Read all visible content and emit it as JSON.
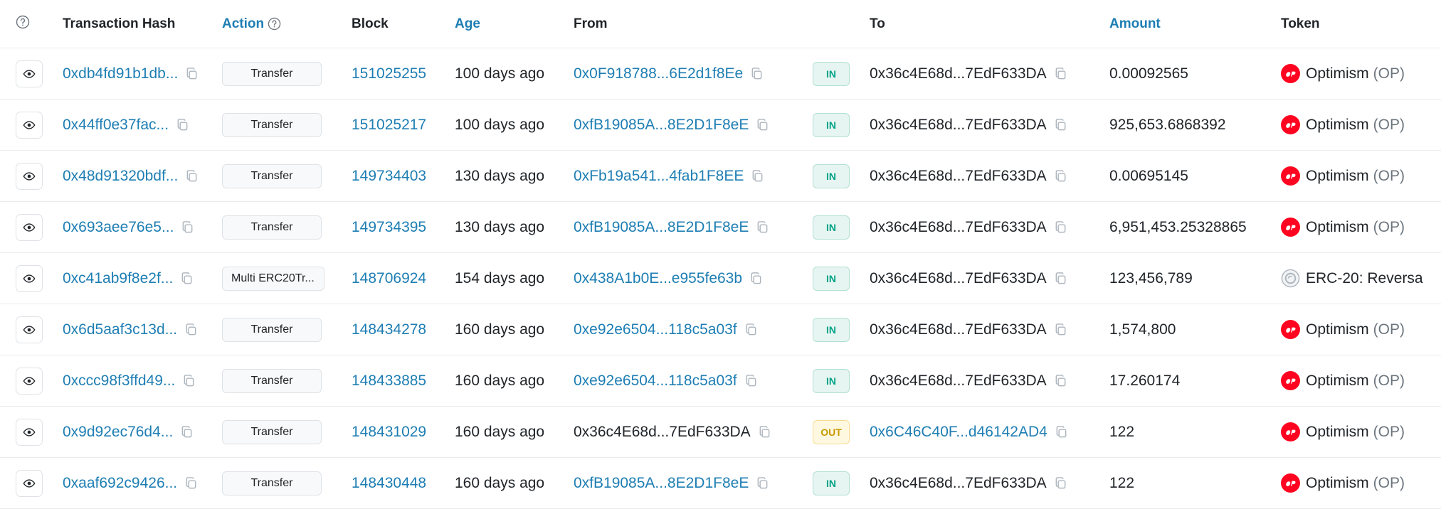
{
  "header": {
    "hash": "Transaction Hash",
    "action": "Action",
    "block": "Block",
    "age": "Age",
    "from": "From",
    "to": "To",
    "amount": "Amount",
    "token": "Token"
  },
  "colors": {
    "link": "#1e7eb3",
    "in": "#00a186",
    "out": "#c69a00",
    "op_red": "#ff0420"
  },
  "icons": {
    "eye": "eye-icon",
    "copy": "copy-icon",
    "help": "question-circle-icon",
    "op": "optimism-logo-icon",
    "erc20": "erc20-token-icon"
  },
  "rows": [
    {
      "hash": "0xdb4fd91b1db...",
      "action": "Transfer",
      "block": "151025255",
      "age": "100 days ago",
      "from": "0x0F918788...6E2d1f8Ee",
      "from_link": true,
      "dir": "IN",
      "to": "0x36c4E68d...7EdF633DA",
      "to_link": false,
      "amount": "0.00092565",
      "token_name": "Optimism",
      "token_sym": "(OP)",
      "token_icon": "op"
    },
    {
      "hash": "0x44ff0e37fac...",
      "action": "Transfer",
      "block": "151025217",
      "age": "100 days ago",
      "from": "0xfB19085A...8E2D1F8eE",
      "from_link": true,
      "dir": "IN",
      "to": "0x36c4E68d...7EdF633DA",
      "to_link": false,
      "amount": "925,653.6868392",
      "token_name": "Optimism",
      "token_sym": "(OP)",
      "token_icon": "op"
    },
    {
      "hash": "0x48d91320bdf...",
      "action": "Transfer",
      "block": "149734403",
      "age": "130 days ago",
      "from": "0xFb19a541...4fab1F8EE",
      "from_link": true,
      "dir": "IN",
      "to": "0x36c4E68d...7EdF633DA",
      "to_link": false,
      "amount": "0.00695145",
      "token_name": "Optimism",
      "token_sym": "(OP)",
      "token_icon": "op"
    },
    {
      "hash": "0x693aee76e5...",
      "action": "Transfer",
      "block": "149734395",
      "age": "130 days ago",
      "from": "0xfB19085A...8E2D1F8eE",
      "from_link": true,
      "dir": "IN",
      "to": "0x36c4E68d...7EdF633DA",
      "to_link": false,
      "amount": "6,951,453.25328865",
      "token_name": "Optimism",
      "token_sym": "(OP)",
      "token_icon": "op"
    },
    {
      "hash": "0xc41ab9f8e2f...",
      "action": "Multi ERC20Tr...",
      "block": "148706924",
      "age": "154 days ago",
      "from": "0x438A1b0E...e955fe63b",
      "from_link": true,
      "dir": "IN",
      "to": "0x36c4E68d...7EdF633DA",
      "to_link": false,
      "amount": "123,456,789",
      "token_name": "ERC-20: Reversa",
      "token_sym": "",
      "token_icon": "erc20"
    },
    {
      "hash": "0x6d5aaf3c13d...",
      "action": "Transfer",
      "block": "148434278",
      "age": "160 days ago",
      "from": "0xe92e6504...118c5a03f",
      "from_link": true,
      "dir": "IN",
      "to": "0x36c4E68d...7EdF633DA",
      "to_link": false,
      "amount": "1,574,800",
      "token_name": "Optimism",
      "token_sym": "(OP)",
      "token_icon": "op"
    },
    {
      "hash": "0xccc98f3ffd49...",
      "action": "Transfer",
      "block": "148433885",
      "age": "160 days ago",
      "from": "0xe92e6504...118c5a03f",
      "from_link": true,
      "dir": "IN",
      "to": "0x36c4E68d...7EdF633DA",
      "to_link": false,
      "amount": "17.260174",
      "token_name": "Optimism",
      "token_sym": "(OP)",
      "token_icon": "op"
    },
    {
      "hash": "0x9d92ec76d4...",
      "action": "Transfer",
      "block": "148431029",
      "age": "160 days ago",
      "from": "0x36c4E68d...7EdF633DA",
      "from_link": false,
      "dir": "OUT",
      "to": "0x6C46C40F...d46142AD4",
      "to_link": true,
      "amount": "122",
      "token_name": "Optimism",
      "token_sym": "(OP)",
      "token_icon": "op"
    },
    {
      "hash": "0xaaf692c9426...",
      "action": "Transfer",
      "block": "148430448",
      "age": "160 days ago",
      "from": "0xfB19085A...8E2D1F8eE",
      "from_link": true,
      "dir": "IN",
      "to": "0x36c4E68d...7EdF633DA",
      "to_link": false,
      "amount": "122",
      "token_name": "Optimism",
      "token_sym": "(OP)",
      "token_icon": "op"
    }
  ]
}
